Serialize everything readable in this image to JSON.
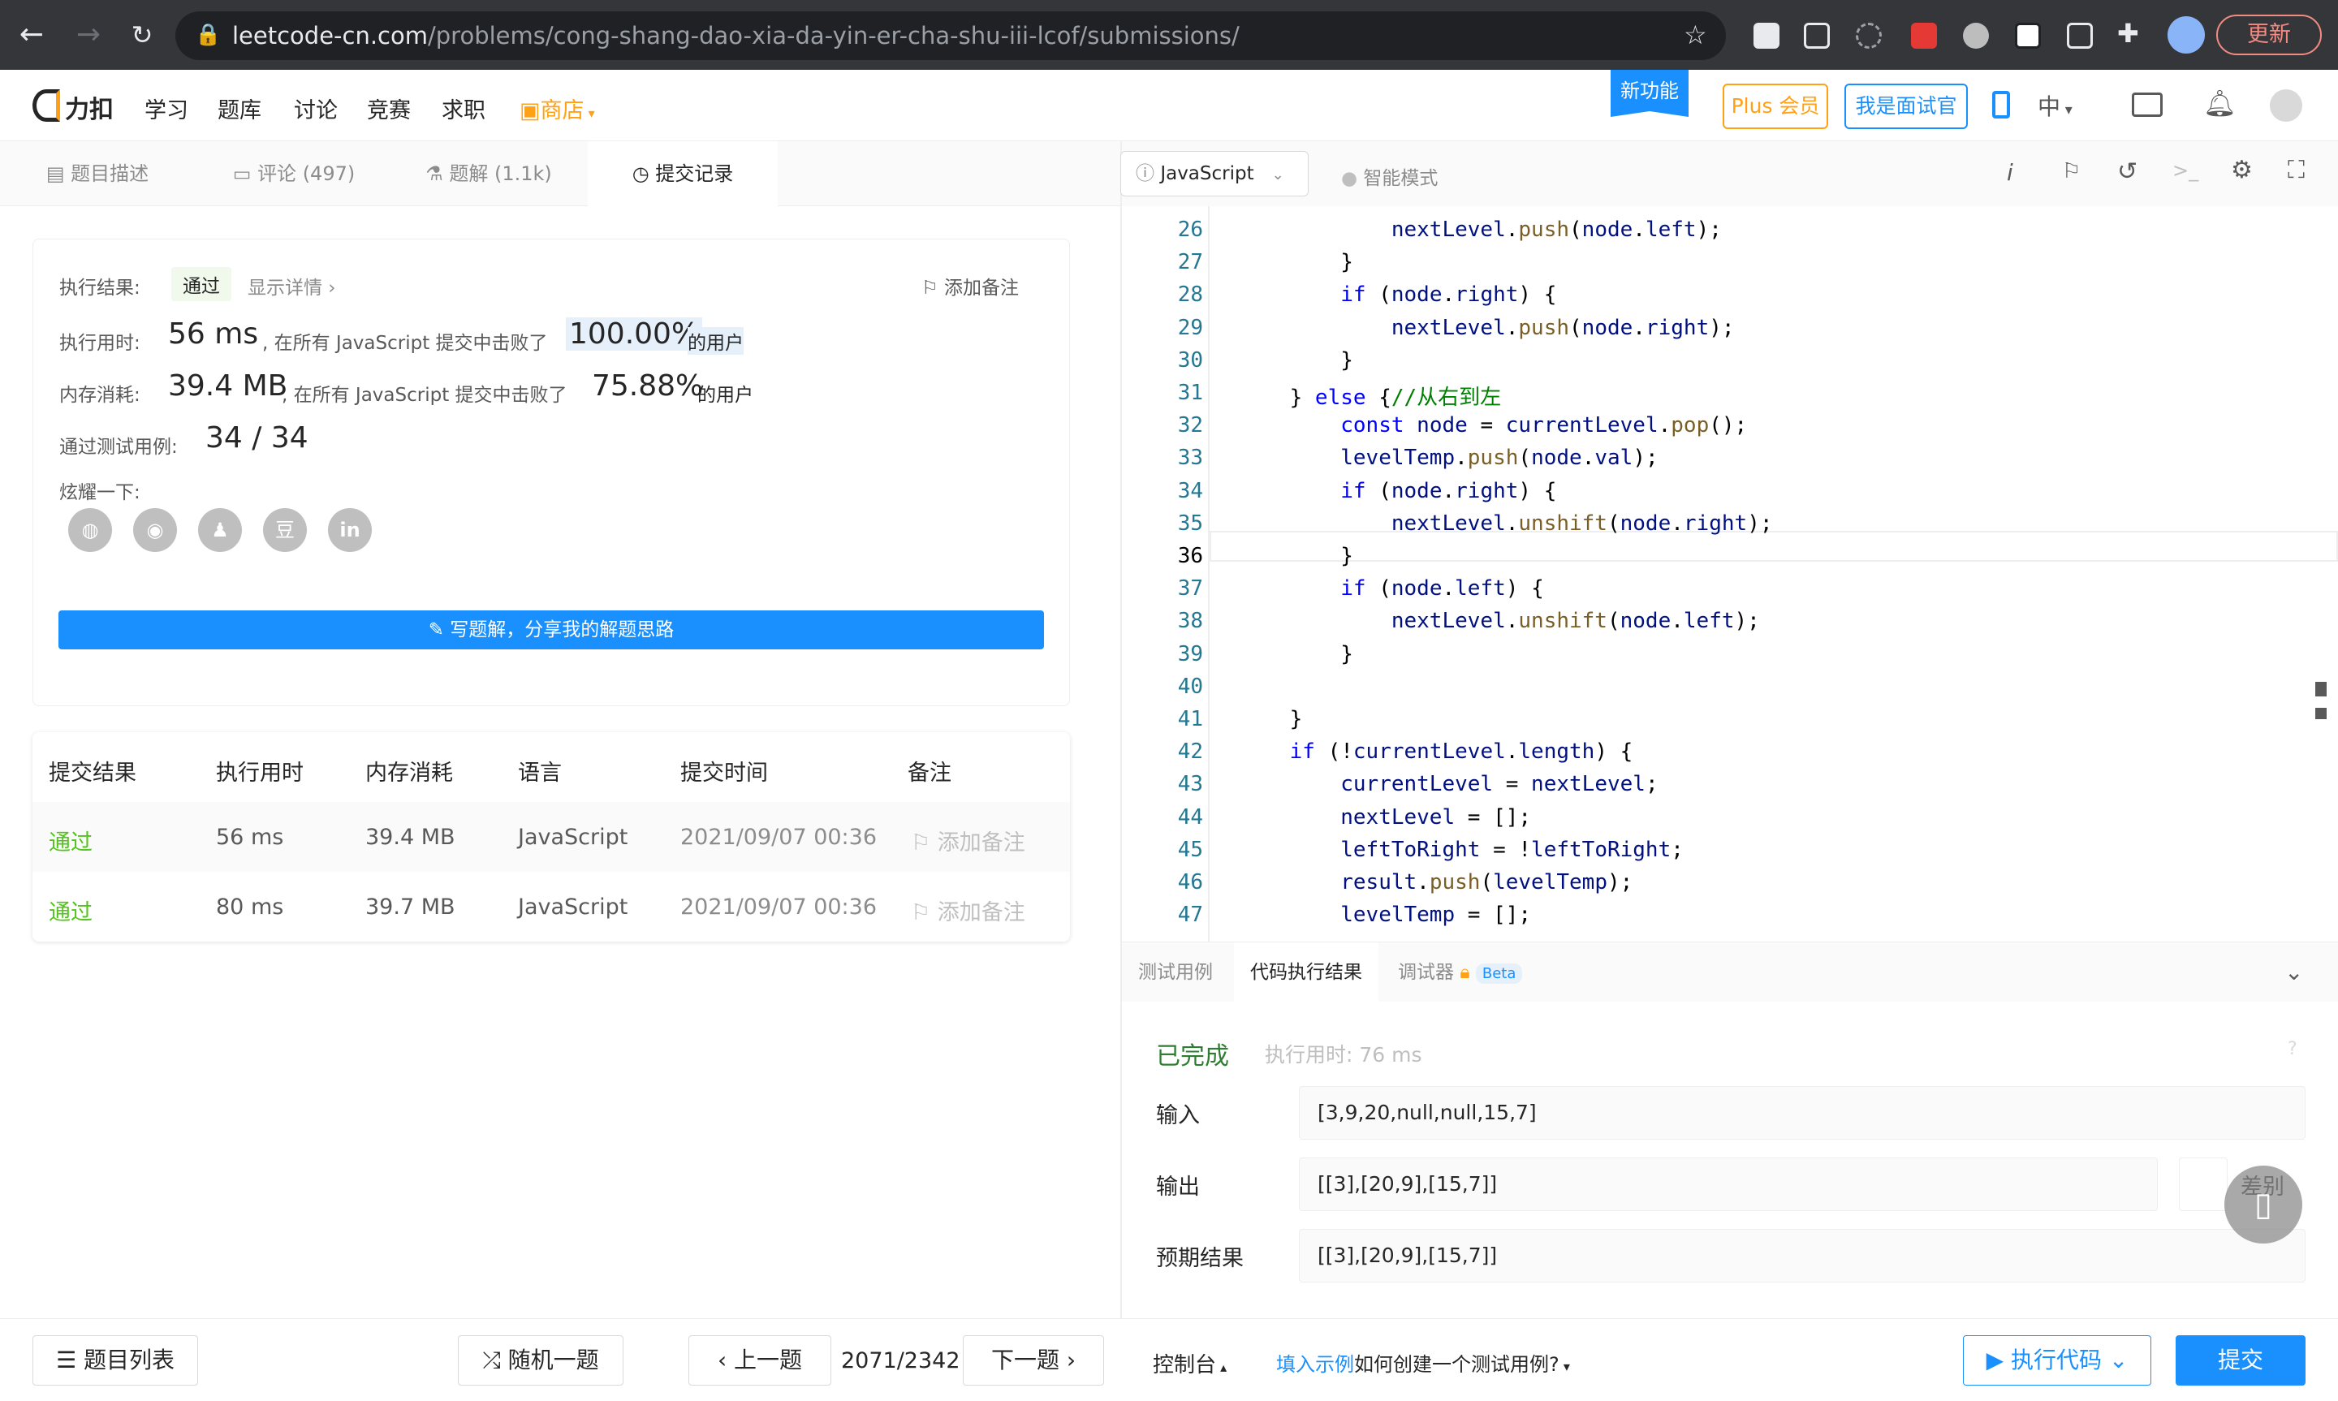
{
  "browser": {
    "url_host": "leetcode-cn.com",
    "url_path": "/problems/cong-shang-dao-xia-da-yin-er-cha-shu-iii-lcof/submissions/",
    "update_label": "更新"
  },
  "header": {
    "logo_text": "力扣",
    "nav": [
      "学习",
      "题库",
      "讨论",
      "竞赛",
      "求职"
    ],
    "store": "商店",
    "new_feature": "新功能",
    "plus": "Plus 会员",
    "interviewer": "我是面试官",
    "lang_switch": "中"
  },
  "left_tabs": [
    {
      "label": "题目描述"
    },
    {
      "label": "评论 (497)"
    },
    {
      "label": "题解 (1.1k)"
    },
    {
      "label": "提交记录"
    }
  ],
  "result_card": {
    "status_label": "执行结果:",
    "status": "通过",
    "details": "显示详情 ›",
    "add_note": "添加备注",
    "time_label": "执行用时:",
    "time_value": "56 ms",
    "time_text": ", 在所有 JavaScript 提交中击败了",
    "time_pct": "100.00%",
    "users": "的用户",
    "mem_label": "内存消耗:",
    "mem_value": "39.4 MB",
    "mem_text": ", 在所有 JavaScript 提交中击败了",
    "mem_pct": "75.88%",
    "tests_label": "通过测试用例:",
    "tests_value": "34 / 34",
    "share_label": "炫耀一下:",
    "write_btn": "写题解，分享我的解题思路"
  },
  "submissions": {
    "headers": [
      "提交结果",
      "执行用时",
      "内存消耗",
      "语言",
      "提交时间",
      "备注"
    ],
    "rows": [
      {
        "result": "通过",
        "time": "56 ms",
        "memory": "39.4 MB",
        "lang": "JavaScript",
        "date": "2021/09/07 00:36",
        "note": "添加备注"
      },
      {
        "result": "通过",
        "time": "80 ms",
        "memory": "39.7 MB",
        "lang": "JavaScript",
        "date": "2021/09/07 00:36",
        "note": "添加备注"
      }
    ]
  },
  "editor": {
    "language": "JavaScript",
    "mode": "智能模式",
    "lines": [
      {
        "n": "26",
        "html": "            <span class=\"vr\">nextLevel</span>.<span class=\"fn\">push</span>(<span class=\"vr\">node</span>.<span class=\"vr\">left</span>);"
      },
      {
        "n": "27",
        "html": "        }"
      },
      {
        "n": "28",
        "html": "        <span class=\"kw\">if</span> (<span class=\"vr\">node</span>.<span class=\"vr\">right</span>) {"
      },
      {
        "n": "29",
        "html": "            <span class=\"vr\">nextLevel</span>.<span class=\"fn\">push</span>(<span class=\"vr\">node</span>.<span class=\"vr\">right</span>);"
      },
      {
        "n": "30",
        "html": "        }"
      },
      {
        "n": "31",
        "html": "    } <span class=\"kw\">else</span> {<span class=\"cm\">//从右到左</span>"
      },
      {
        "n": "32",
        "html": "        <span class=\"kw\">const</span> <span class=\"vr\">node</span> = <span class=\"vr\">currentLevel</span>.<span class=\"fn\">pop</span>();"
      },
      {
        "n": "33",
        "html": "        <span class=\"vr\">levelTemp</span>.<span class=\"fn\">push</span>(<span class=\"vr\">node</span>.<span class=\"vr\">val</span>);"
      },
      {
        "n": "34",
        "html": "        <span class=\"kw\">if</span> (<span class=\"vr\">node</span>.<span class=\"vr\">right</span>) {"
      },
      {
        "n": "35",
        "html": "            <span class=\"vr\">nextLevel</span>.<span class=\"fn\">unshift</span>(<span class=\"vr\">node</span>.<span class=\"vr\">right</span>);"
      },
      {
        "n": "36",
        "html": "        }"
      },
      {
        "n": "37",
        "html": "        <span class=\"kw\">if</span> (<span class=\"vr\">node</span>.<span class=\"vr\">left</span>) {"
      },
      {
        "n": "38",
        "html": "            <span class=\"vr\">nextLevel</span>.<span class=\"fn\">unshift</span>(<span class=\"vr\">node</span>.<span class=\"vr\">left</span>);"
      },
      {
        "n": "39",
        "html": "        }"
      },
      {
        "n": "40",
        "html": ""
      },
      {
        "n": "41",
        "html": "    }"
      },
      {
        "n": "42",
        "html": "    <span class=\"kw\">if</span> (!<span class=\"vr\">currentLevel</span>.<span class=\"vr\">length</span>) {"
      },
      {
        "n": "43",
        "html": "        <span class=\"vr\">currentLevel</span> = <span class=\"vr\">nextLevel</span>;"
      },
      {
        "n": "44",
        "html": "        <span class=\"vr\">nextLevel</span> = [];"
      },
      {
        "n": "45",
        "html": "        <span class=\"vr\">leftToRight</span> = !<span class=\"vr\">leftToRight</span>;"
      },
      {
        "n": "46",
        "html": "        <span class=\"vr\">result</span>.<span class=\"fn\">push</span>(<span class=\"vr\">levelTemp</span>);"
      },
      {
        "n": "47",
        "html": "        <span class=\"vr\">levelTemp</span> = [];"
      }
    ]
  },
  "bottom_tabs": [
    "测试用例",
    "代码执行结果",
    "调试器"
  ],
  "beta": "Beta",
  "result": {
    "status": "已完成",
    "time": "执行用时: 76 ms",
    "input_label": "输入",
    "input": "[3,9,20,null,null,15,7]",
    "output_label": "输出",
    "output": "[[3],[20,9],[15,7]]",
    "diff": "差别",
    "expected_label": "预期结果",
    "expected": "[[3],[20,9],[15,7]]"
  },
  "footer": {
    "problem_list": "题目列表",
    "random": "随机一题",
    "prev": "上一题",
    "counter": "2071/2342",
    "next": "下一题",
    "console": "控制台",
    "fill_example": "填入示例",
    "how_to": "如何创建一个测试用例?",
    "run": "执行代码",
    "submit": "提交"
  }
}
